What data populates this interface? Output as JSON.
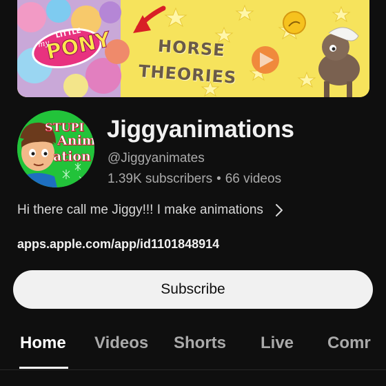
{
  "banner": {
    "line1": "HORSE",
    "line2": "THEORIES"
  },
  "avatar": {
    "line1": "STUPI",
    "line2": "Anim",
    "line3": "ation"
  },
  "channel": {
    "name": "Jiggyanimations",
    "handle": "@Jiggyanimates",
    "subscribers": "1.39K subscribers",
    "separator": "•",
    "videos": "66 videos",
    "description": "Hi there call me Jiggy!!! I make animations",
    "link": "apps.apple.com/app/id1101848914"
  },
  "actions": {
    "subscribe_label": "Subscribe"
  },
  "tabs": [
    {
      "label": "Home",
      "active": true
    },
    {
      "label": "Videos",
      "active": false
    },
    {
      "label": "Shorts",
      "active": false
    },
    {
      "label": "Live",
      "active": false
    },
    {
      "label": "Comr",
      "active": false
    }
  ],
  "colors": {
    "background": "#0f0f0f",
    "text_primary": "#f1f1f1",
    "text_secondary": "#aaaaaa",
    "subscribe_bg": "#f1f1f1",
    "banner_yellow": "#f7e35a",
    "avatar_green": "#1fbe36"
  }
}
